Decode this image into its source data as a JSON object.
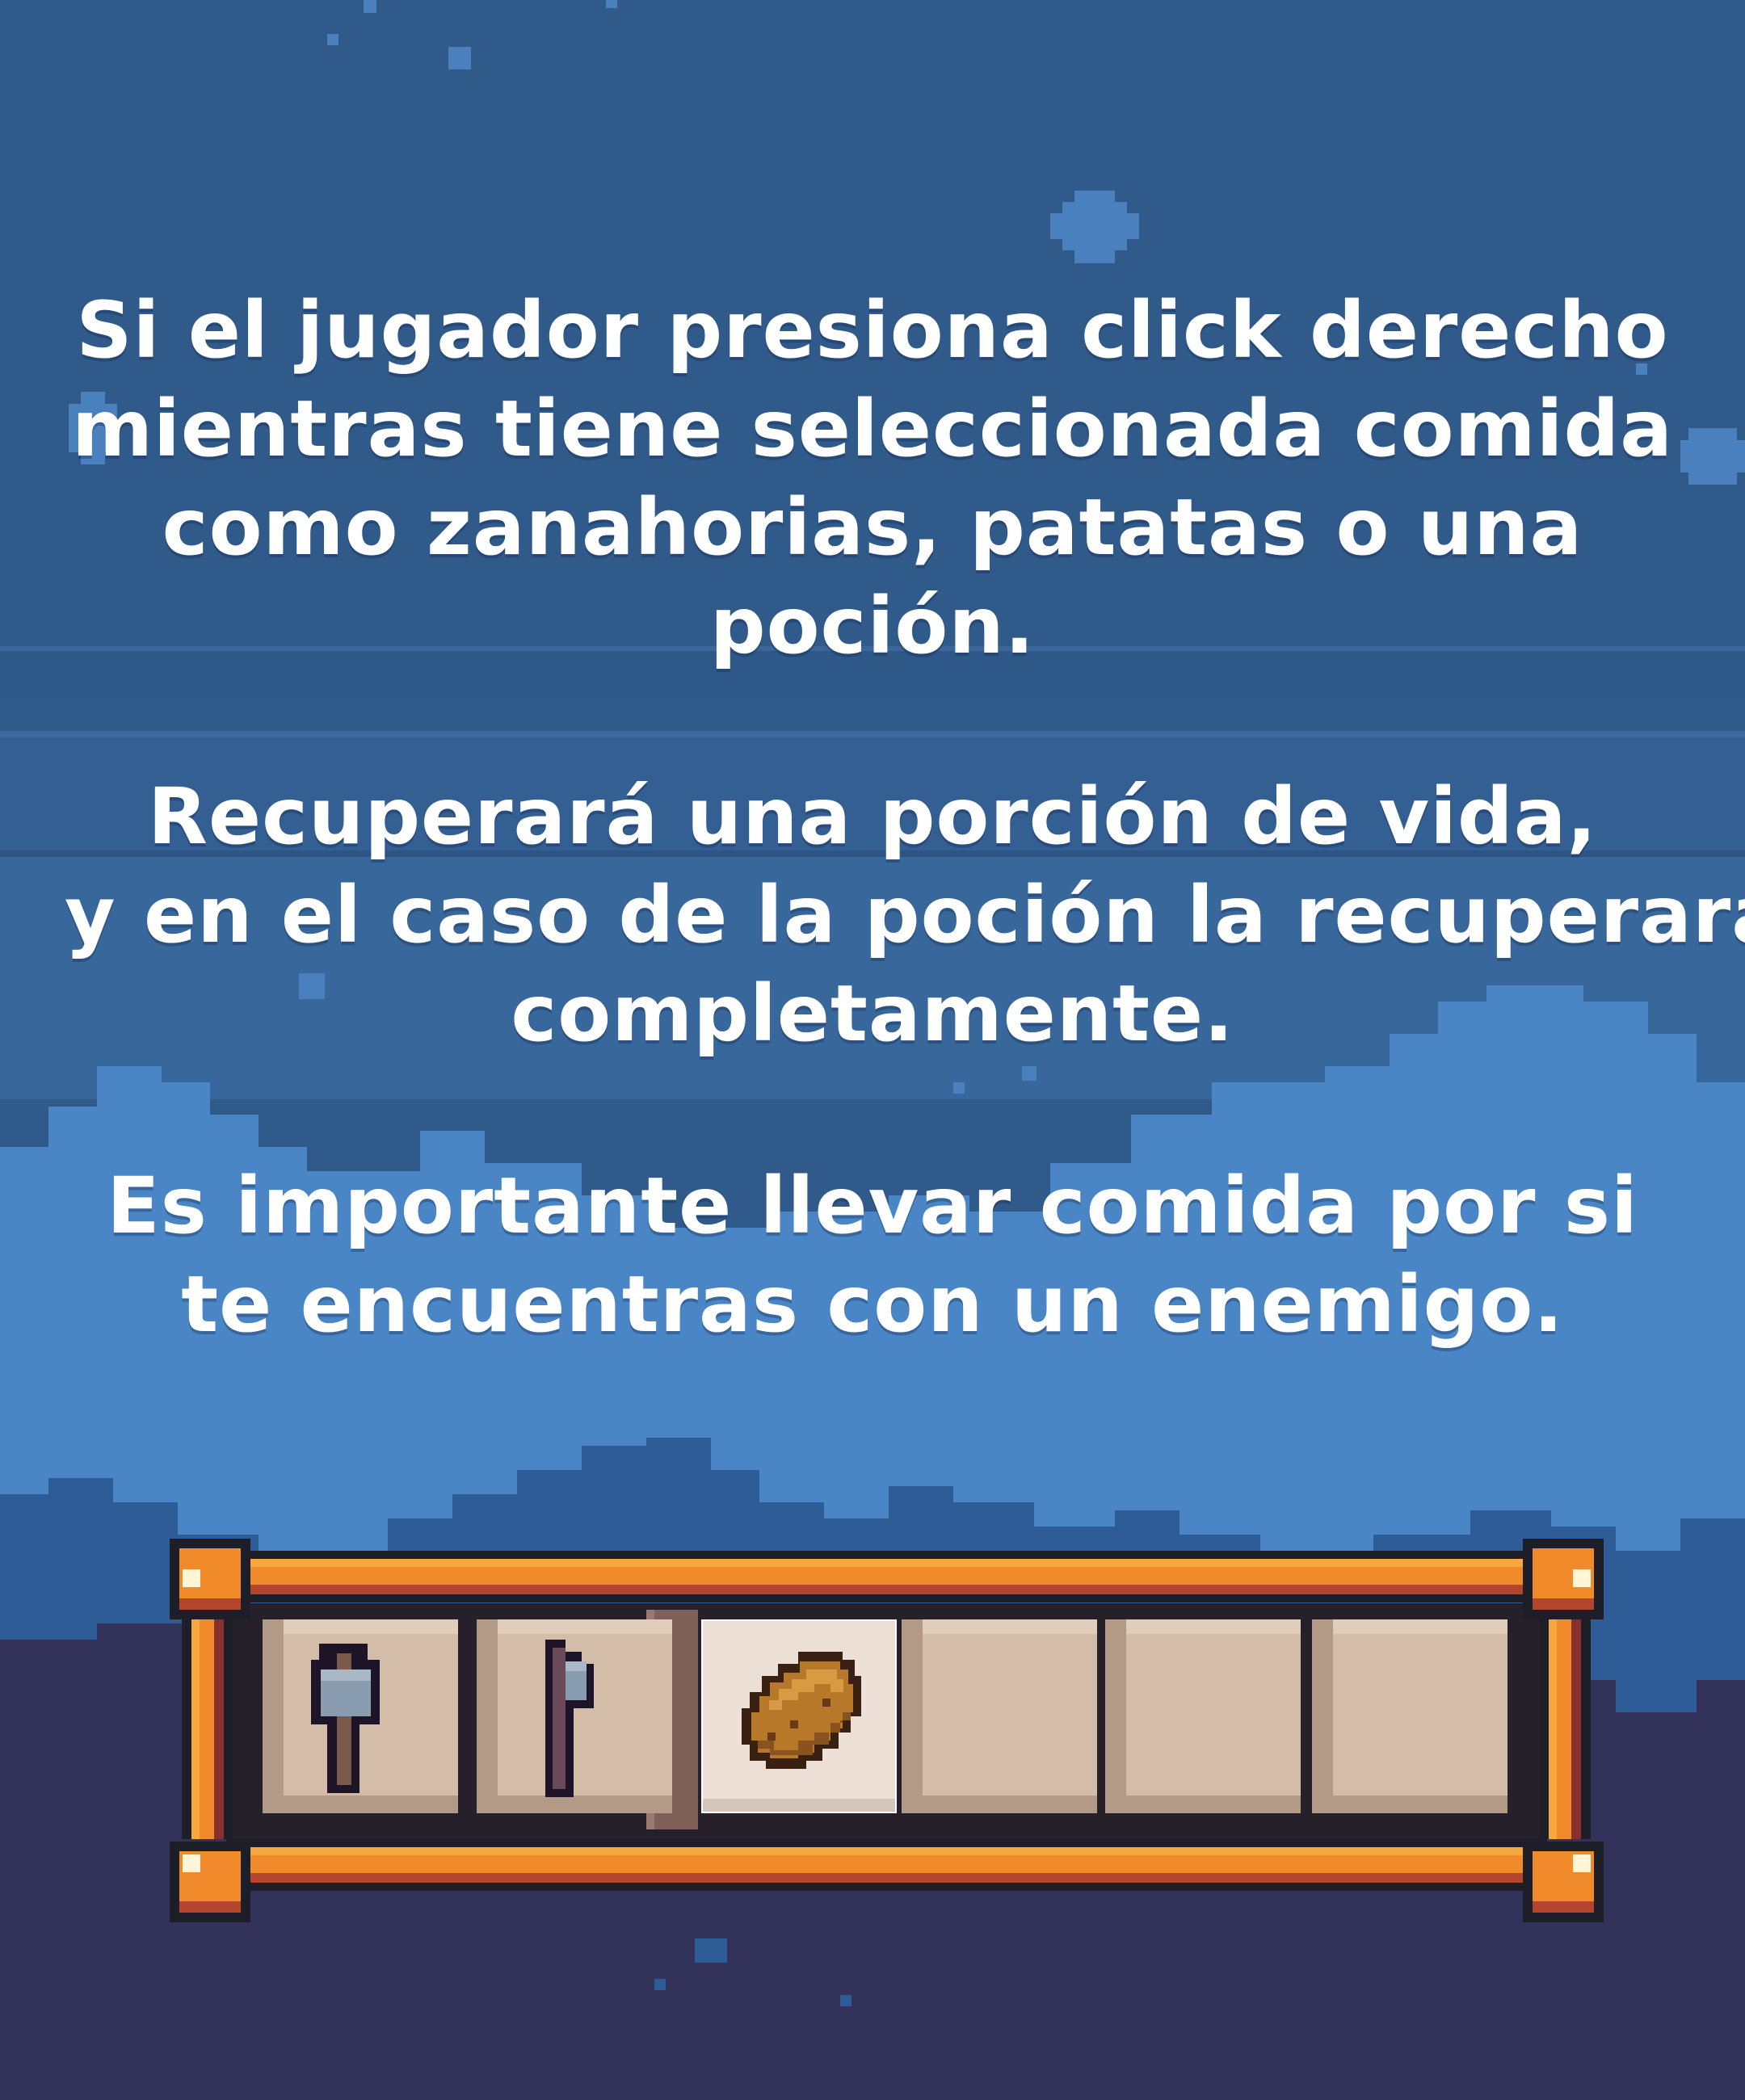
{
  "instructions": {
    "paragraph_1": [
      "Si el jugador presiona click derecho",
      "mientras tiene seleccionada comida",
      "como zanahorias, patatas o una",
      "poción."
    ],
    "paragraph_2": [
      "Recuperará una porción de vida,",
      "y en el caso de la poción la recuperara",
      "completamente."
    ],
    "paragraph_3": [
      "Es importante llevar comida por si",
      "te encuentras con un enemigo."
    ]
  },
  "hotbar": {
    "selected_slot": 3,
    "slots": [
      {
        "item_icon": "hammer-icon"
      },
      {
        "item_icon": "axe-icon"
      },
      {
        "item_icon": "potato-icon"
      },
      {
        "item_icon": ""
      },
      {
        "item_icon": ""
      },
      {
        "item_icon": ""
      }
    ]
  },
  "colors": {
    "sky": "#2f5a8a",
    "cloud_light": "#4a86c6",
    "cloud_dark": "#2d5c96",
    "ground": "#32325a",
    "frame_orange": "#f08a2a",
    "slot": "#d4bda8",
    "text": "#ffffff"
  }
}
